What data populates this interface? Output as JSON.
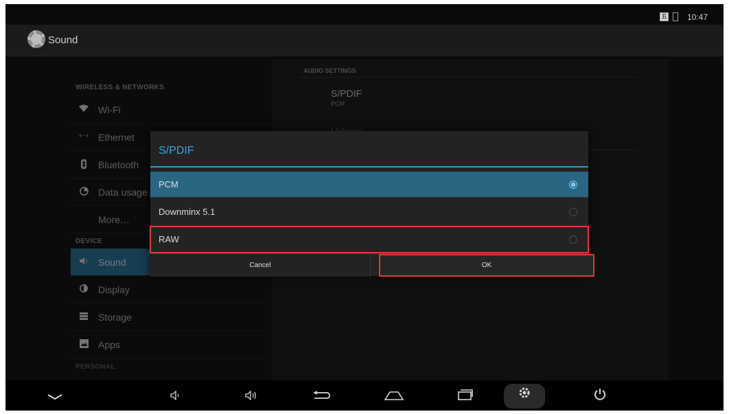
{
  "status_bar": {
    "ime_label": "五",
    "time": "10:47"
  },
  "action_bar": {
    "title": "Sound"
  },
  "left_pane": {
    "sections": [
      {
        "header": "WIRELESS & NETWORKS",
        "items": [
          {
            "label": "Wi-Fi",
            "icon": "wifi-icon"
          },
          {
            "label": "Ethernet",
            "icon": "ethernet-icon"
          },
          {
            "label": "Bluetooth",
            "icon": "bluetooth-icon"
          },
          {
            "label": "Data usage",
            "icon": "data-usage-icon"
          },
          {
            "label": "More…",
            "icon": ""
          }
        ]
      },
      {
        "header": "DEVICE",
        "items": [
          {
            "label": "Sound",
            "icon": "sound-icon",
            "selected": true
          },
          {
            "label": "Display",
            "icon": "display-icon"
          },
          {
            "label": "Storage",
            "icon": "storage-icon"
          },
          {
            "label": "Apps",
            "icon": "apps-icon"
          }
        ]
      },
      {
        "header": "PERSONAL",
        "items": []
      }
    ]
  },
  "right_pane": {
    "section_header": "AUDIO SETTINGS",
    "spdif": {
      "title": "S/PDIF",
      "summary": "PCM"
    },
    "volume": {
      "title": "Volume"
    }
  },
  "dialog": {
    "title": "S/PDIF",
    "options": [
      {
        "label": "PCM",
        "checked": true
      },
      {
        "label": "Downminx 5.1",
        "checked": false
      },
      {
        "label": "RAW",
        "checked": false
      }
    ],
    "cancel_label": "Cancel",
    "ok_label": "OK"
  },
  "nav_bar": {
    "buttons": [
      "hide-bar-icon",
      "volume-down-icon",
      "volume-up-icon",
      "back-icon",
      "home-icon",
      "recents-icon",
      "settings-icon",
      "power-icon"
    ]
  },
  "colors": {
    "accent": "#39a9db",
    "selected_item": "#2a6f94",
    "highlight_outline": "#e53935"
  }
}
